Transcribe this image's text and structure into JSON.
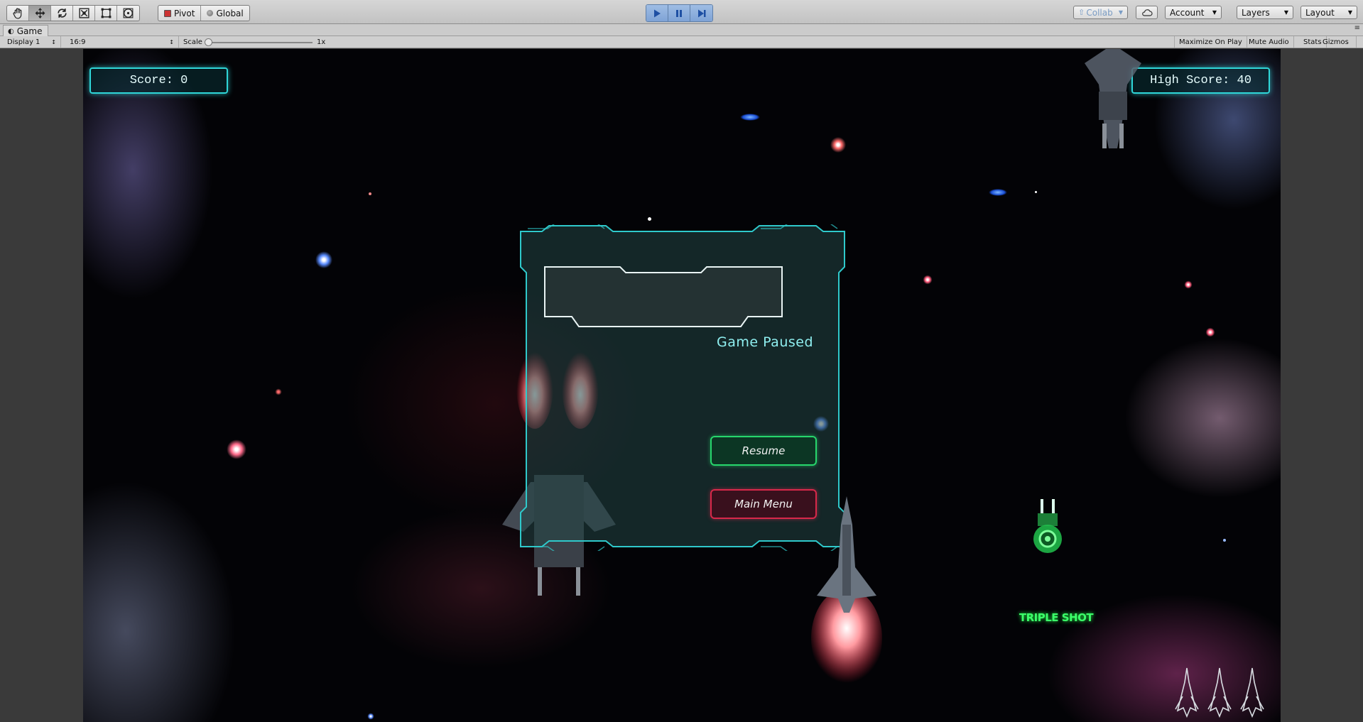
{
  "toolbar": {
    "transform_tools": [
      "hand-tool",
      "move-tool",
      "rotate-tool",
      "scale-tool",
      "rect-tool",
      "transform-tool"
    ],
    "pivot_label": "Pivot",
    "global_label": "Global",
    "playback": [
      "play",
      "pause",
      "step"
    ],
    "collab_label": "Collab",
    "account_label": "Account",
    "layers_label": "Layers",
    "layout_label": "Layout"
  },
  "game_tab": {
    "title": "Game",
    "display": "Display 1",
    "aspect": "16:9",
    "scale_label": "Scale",
    "scale_value": "1x",
    "maximize_on_play": "Maximize On Play",
    "mute_audio": "Mute Audio",
    "stats": "Stats",
    "gizmos": "Gizmos"
  },
  "game": {
    "score": "Score: 0",
    "high_score": "High Score: 40",
    "pause_title": "Game Paused",
    "resume_label": "Resume",
    "main_menu_label": "Main Menu",
    "powerup_label": "TRIPLE SHOT",
    "lives_remaining": 3,
    "colors": {
      "hud_cyan": "#2fd6d8",
      "resume_green": "#27d66c",
      "menu_red": "#d8284a",
      "powerup_green": "#3cff6a"
    }
  }
}
